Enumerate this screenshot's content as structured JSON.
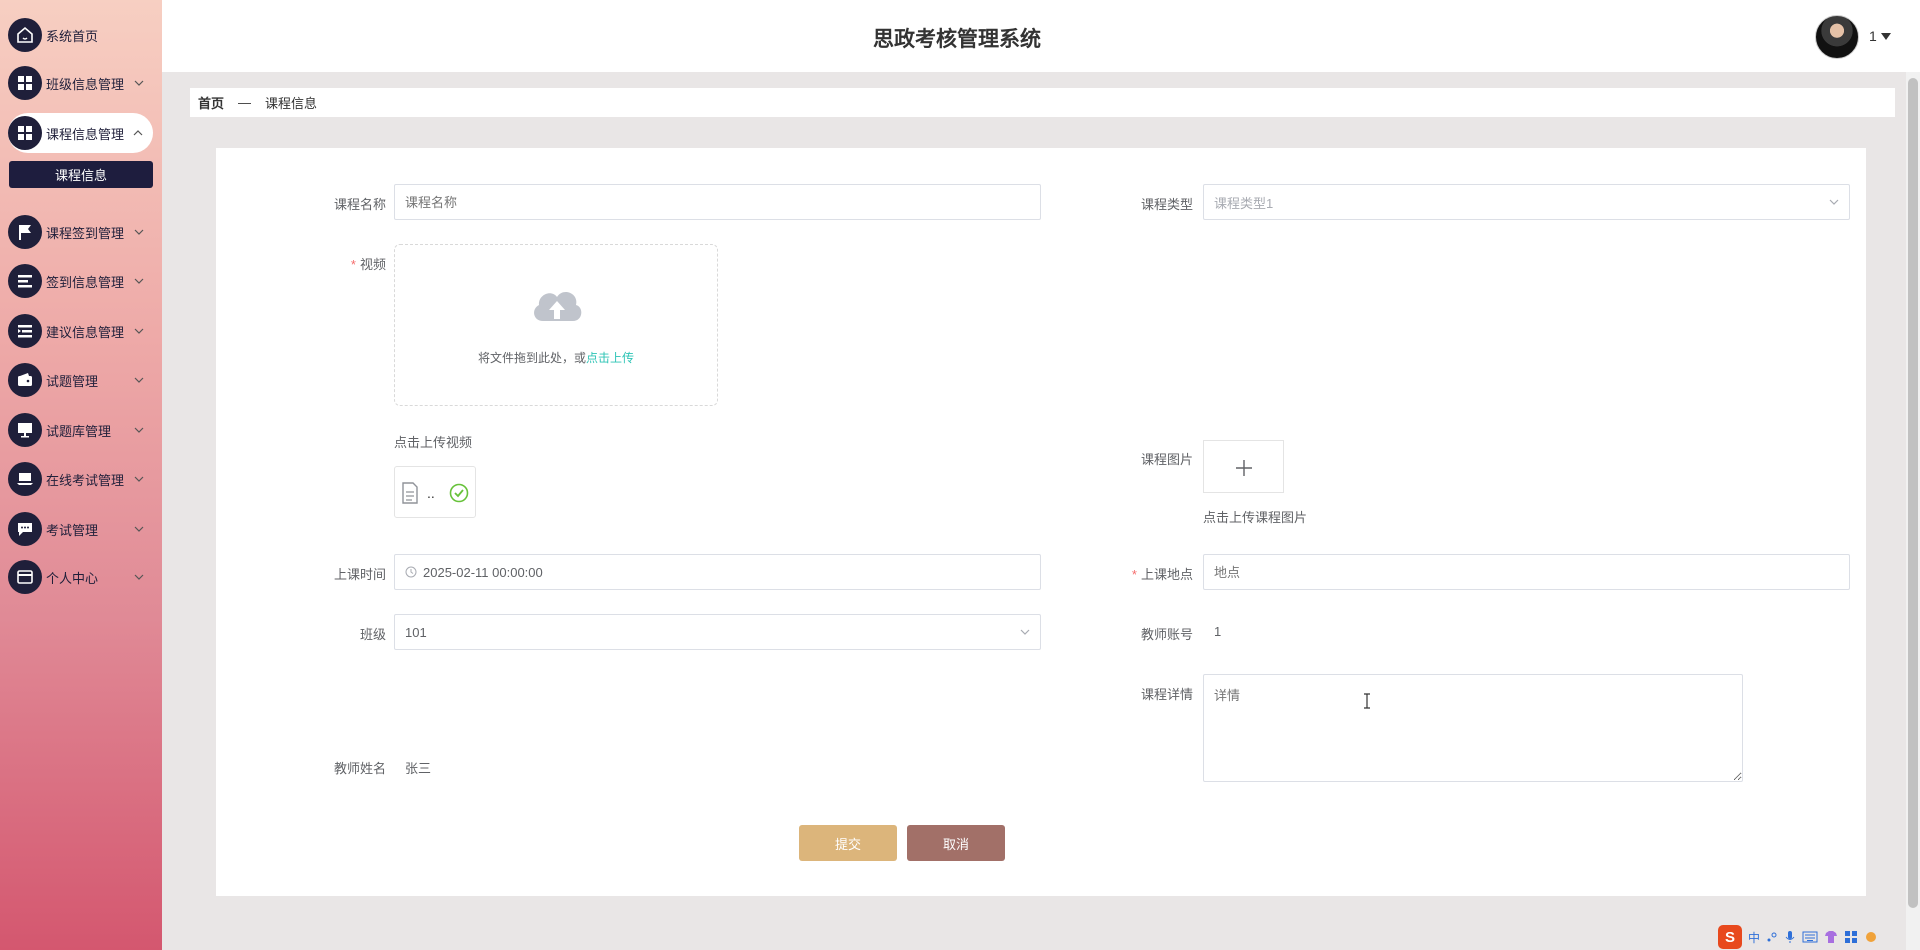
{
  "header": {
    "title": "思政考核管理系统",
    "user_name": "1"
  },
  "sidebar": {
    "items": [
      {
        "label": "系统首页",
        "icon": "home-icon"
      },
      {
        "label": "班级信息管理",
        "icon": "grid-icon"
      },
      {
        "label": "课程信息管理",
        "icon": "grid-icon"
      },
      {
        "label": "课程签到管理",
        "icon": "flag-icon"
      },
      {
        "label": "签到信息管理",
        "icon": "list-icon"
      },
      {
        "label": "建议信息管理",
        "icon": "list-indent-icon"
      },
      {
        "label": "试题管理",
        "icon": "wallet-icon"
      },
      {
        "label": "试题库管理",
        "icon": "monitor-icon"
      },
      {
        "label": "在线考试管理",
        "icon": "laptop-icon"
      },
      {
        "label": "考试管理",
        "icon": "chat-icon"
      },
      {
        "label": "个人中心",
        "icon": "card-icon"
      }
    ],
    "sub_item": "课程信息"
  },
  "breadcrumb": {
    "home": "首页",
    "sep": "—",
    "current": "课程信息"
  },
  "form": {
    "course_name_label": "课程名称",
    "course_name_placeholder": "课程名称",
    "course_type_label": "课程类型",
    "course_type_value": "课程类型1",
    "video_label": "视频",
    "upload_drag_text": "将文件拖到此处，或",
    "upload_click_text": "点击上传",
    "video_tip": "点击上传视频",
    "file_name": "..",
    "image_label": "课程图片",
    "image_tip": "点击上传课程图片",
    "time_label": "上课时间",
    "time_value": "2025-02-11 00:00:00",
    "location_label": "上课地点",
    "location_placeholder": "地点",
    "class_label": "班级",
    "class_value": "101",
    "teacher_account_label": "教师账号",
    "teacher_account_value": "1",
    "detail_label": "课程详情",
    "detail_placeholder": "详情",
    "teacher_name_label": "教师姓名",
    "teacher_name_value": "张三",
    "submit": "提交",
    "cancel": "取消"
  },
  "ime": {
    "lang": "中"
  },
  "colors": {
    "sidebar_dark": "#1f1f3a",
    "submit_btn": "#dcb57b",
    "cancel_btn": "#a27068",
    "link": "#2ec4b6",
    "required": "#f56c6c"
  }
}
